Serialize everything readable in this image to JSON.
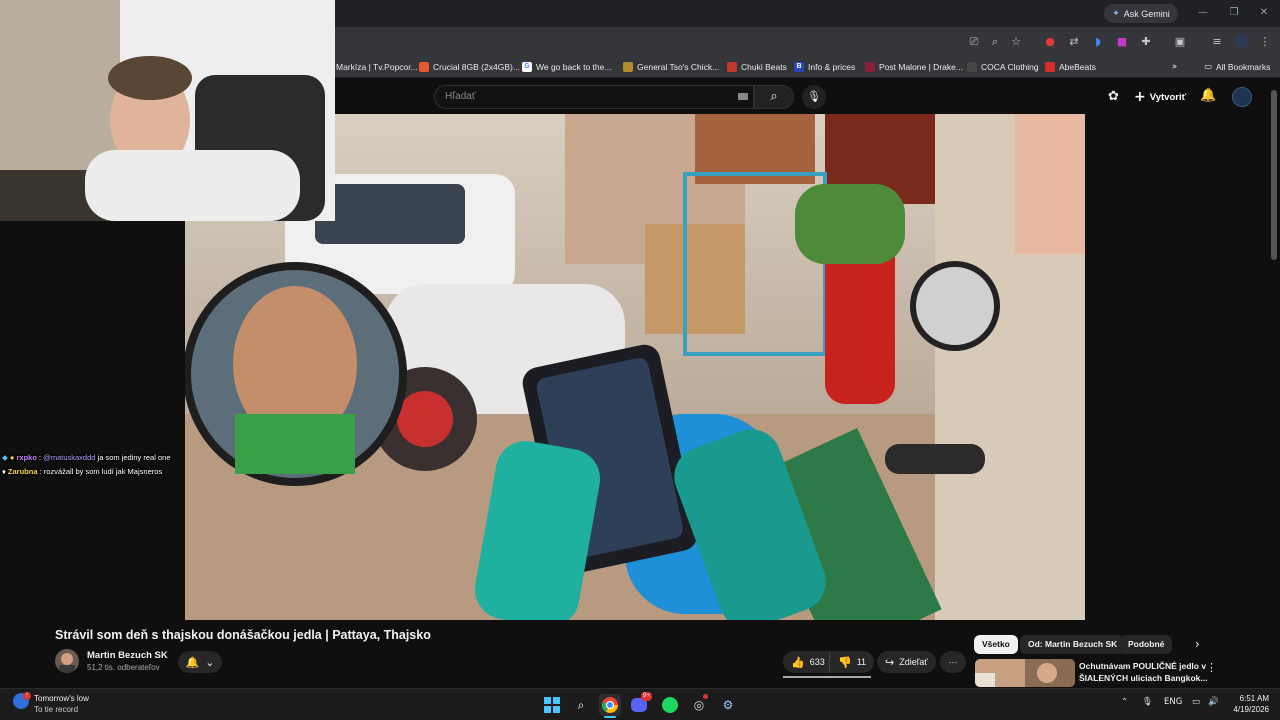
{
  "browser": {
    "gemini_label": "Ask Gemini",
    "bookmarks": [
      {
        "label": "Markíza | Tv.Popcor...",
        "color": "#f0a020"
      },
      {
        "label": "Crucial 8GB (2x4GB)...",
        "color": "#e55a2b"
      },
      {
        "label": "We go back to the...",
        "color": "#1f1f1f"
      },
      {
        "label": "General Tso's Chick...",
        "color": "#b38b2d"
      },
      {
        "label": "Chuki Beats",
        "color": "#c0392b"
      },
      {
        "label": "Info & prices",
        "color": "#2747b8"
      },
      {
        "label": "Post Malone | Drake...",
        "color": "#8a1e3a"
      },
      {
        "label": "COCA Clothing",
        "color": "#444444"
      },
      {
        "label": "AbeBeats",
        "color": "#d62c2c"
      }
    ],
    "all_bookmarks_label": "All Bookmarks"
  },
  "youtube": {
    "search_placeholder": "Hľadať",
    "create_label": "Vytvoriť",
    "video_title": "Strávil som deň s thajskou donášačkou jedla | Pattaya, Thajsko",
    "channel_name": "Martin Bezuch SK",
    "subscribers": "51,2 tis. odberateľov",
    "likes": "633",
    "dislikes": "11",
    "share_label": "Zdieľať",
    "chips": [
      "Všetko",
      "Od: Martin Bezuch SK",
      "Podobné"
    ],
    "recommendation": {
      "title_line1": "Ochutnávam POULIČNÉ jedlo v",
      "title_line2": "ŠIALENÝCH uliciach Bangkok..."
    }
  },
  "chat": [
    {
      "user": "rxpko",
      "user_color": "#c77dff",
      "mention": "@matuskaxddd",
      "text": "ja som jediny real one"
    },
    {
      "user": "Zarubna",
      "user_color": "#f7d24a",
      "mention": "",
      "text": ": rozvážall by som ludí jak Majsneros"
    }
  ],
  "taskbar": {
    "weather_line1": "Tomorrow's low",
    "weather_line2": "To tie record",
    "lang": "ENG",
    "time": "6:51 AM",
    "date": "4/19/2026",
    "discord_badge": "9+"
  }
}
